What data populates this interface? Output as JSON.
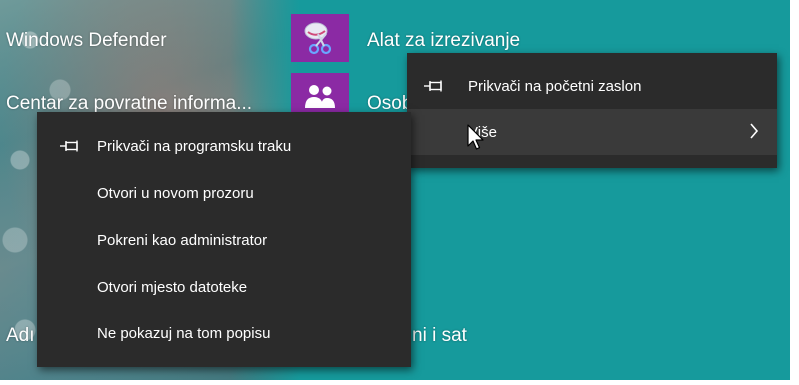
{
  "colors": {
    "desktop_teal": "#169a9c",
    "menu_bg": "#2b2b2b",
    "menu_hover": "#3a3a3a",
    "tile_purple": "#8b2aa4",
    "text": "#ffffff"
  },
  "start_list": {
    "windows_defender": "Windows Defender",
    "feedback_center": "Centar za povratne informa...",
    "snipping_tool": "Alat za izrezivanje",
    "people_partial": "Osob",
    "admin_partial": "Adı",
    "datetime_partial": "ni i sat"
  },
  "tile_icons": {
    "snipping": "scissors-icon",
    "people": "people-icon"
  },
  "right_menu": {
    "pin_start": "Prikvači na početni zaslon",
    "more": "Više",
    "more_icon": "chevron-right-icon"
  },
  "left_menu": {
    "items": [
      "Prikvači na programsku traku",
      "Otvori u novom prozoru",
      "Pokreni kao administrator",
      "Otvori mjesto datoteke",
      "Ne pokazuj na tom popisu"
    ]
  }
}
